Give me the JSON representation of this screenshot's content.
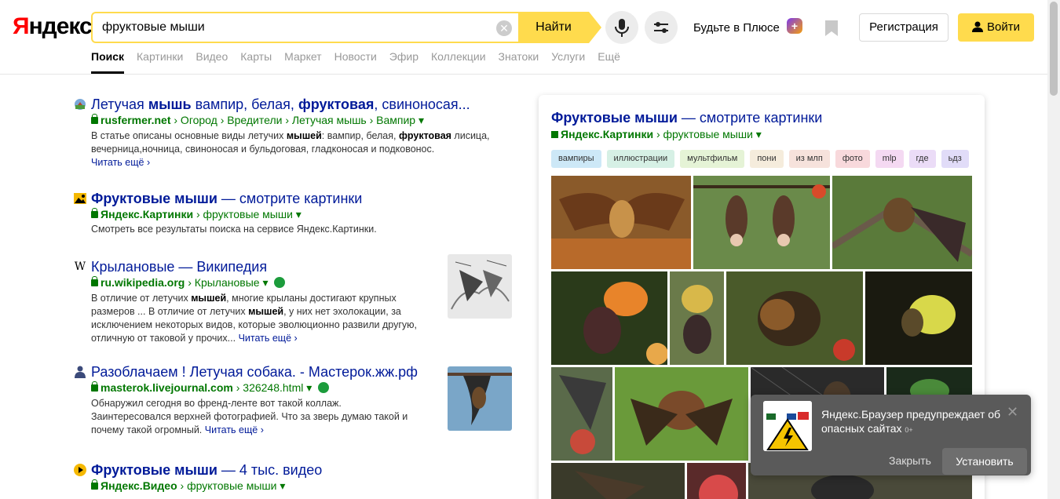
{
  "header": {
    "logo_first": "Я",
    "logo_rest": "ндекс",
    "search_value": "фруктовые мыши",
    "find_label": "Найти",
    "plus_label": "Будьте в Плюсе",
    "plus_badge": "+",
    "register_label": "Регистрация",
    "login_label": "Войти"
  },
  "tabs": [
    "Поиск",
    "Картинки",
    "Видео",
    "Карты",
    "Маркет",
    "Новости",
    "Эфир",
    "Коллекции",
    "Знатоки",
    "Услуги",
    "Ещё"
  ],
  "results": [
    {
      "title_parts": [
        "Летучая ",
        "мышь",
        " вампир, белая, ",
        "фруктовая",
        ", свиноносая..."
      ],
      "url_domain": "rusfermer.net",
      "url_path": " › Огород › Вредители › Летучая мышь › Вампир ▾",
      "snippet_1": "В статье описаны основные виды летучих ",
      "snippet_b1": "мышей",
      "snippet_2": ": вампир, белая, ",
      "snippet_b2": "фруктовая",
      "snippet_3": " лисица,",
      "snippet_line2": "вечерница,ночница, свиноносая и бульдоговая, гладконосая и подковонос.",
      "more": "Читать ещё ›"
    },
    {
      "title_bold": "Фруктовые мыши",
      "title_rest": " — смотрите картинки",
      "url_domain": "Яндекс.Картинки",
      "url_path": " › фруктовые мыши ▾",
      "snippet": "Смотреть все результаты поиска на сервисе Яндекс.Картинки."
    },
    {
      "icon_letter": "W",
      "title": "Крылановые — Википедия",
      "url_domain": "ru.wikipedia.org",
      "url_path": " › Крылановые ▾",
      "l1a": "В отличие от летучих ",
      "l1b": "мышей",
      "l1c": ", многие крыланы достигают крупных",
      "l2a": "размеров ... В отличие от летучих ",
      "l2b": "мышей",
      "l2c": ", у них нет эхолокации, за",
      "l3": "исключением некоторых видов, которые эволюционно развили другую,",
      "l4": "отличную от таковой у прочих... ",
      "more": "Читать ещё ›"
    },
    {
      "title": "Разоблачаем ! Летучая собака. - Мастерок.жж.рф",
      "url_domain": "masterok.livejournal.com",
      "url_path": " › 326248.html ▾",
      "l1": "Обнаружил сегодня во френд-ленте вот такой коллаж.",
      "l2": "Заинтересовался верхней фотографией. Что за зверь думаю такой и",
      "l3": "почему такой огромный. ",
      "more": "Читать ещё ›"
    },
    {
      "title_bold": "Фруктовые мыши",
      "title_rest": " — 4 тыс. видео",
      "url_domain": "Яндекс.Видео",
      "url_path": " › фруктовые мыши ▾"
    }
  ],
  "panel": {
    "title_bold": "Фруктовые мыши",
    "title_rest": " — смотрите картинки",
    "url_domain": "Яндекс.Картинки",
    "url_path": " › фруктовые мыши ▾",
    "chips": [
      {
        "label": "вампиры",
        "color": "#cde8f7"
      },
      {
        "label": "иллюстрации",
        "color": "#d6f0e5"
      },
      {
        "label": "мультфильм",
        "color": "#e5f3d6"
      },
      {
        "label": "пони",
        "color": "#f5ecdc"
      },
      {
        "label": "из млп",
        "color": "#f6e2dc"
      },
      {
        "label": "фото",
        "color": "#f8d9dc"
      },
      {
        "label": "mlp",
        "color": "#f4d9f2"
      },
      {
        "label": "где",
        "color": "#ebdcf7"
      },
      {
        "label": "ьдз",
        "color": "#e1dcf8"
      }
    ]
  },
  "notification": {
    "text": "Яндекс.Браузер предупреждает об опасных сайтах",
    "suffix": "0+",
    "close": "✕",
    "dismiss": "Закрыть",
    "install": "Установить"
  }
}
